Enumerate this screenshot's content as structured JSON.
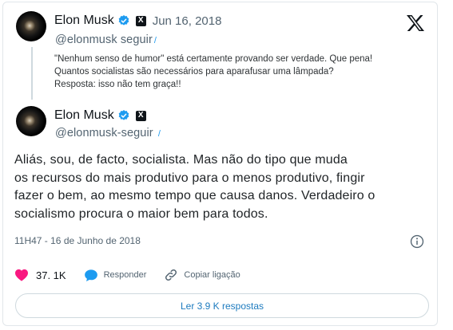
{
  "brand": {
    "logo": "x-logo",
    "accent_color": "#1d9bf0",
    "like_color": "#f91880"
  },
  "quoted_tweet": {
    "author_name": "Elon Musk",
    "author_handle": "@elonmusk",
    "follow_label": "seguir",
    "date": "Jun 16, 2018",
    "lines": [
      "\"Nenhum senso de humor\" está certamente provando ser verdade. Que pena!",
      "Quantos socialistas são necessários para aparafusar uma lâmpada?",
      "Resposta: isso não tem graça!!"
    ]
  },
  "main_tweet": {
    "author_name": "Elon Musk",
    "author_handle": "@elonmusk",
    "follow_label": "seguir",
    "text_lines": [
      "Aliás, sou, de facto, socialista. Mas não do tipo que muda",
      "os recursos do mais produtivo para o menos produtivo, fingir",
      "fazer o bem, ao mesmo tempo que causa danos. Verdadeiro o",
      "socialismo procura o maior bem para todos."
    ],
    "timestamp": "11H47 - 16 de Junho de 2018"
  },
  "actions": {
    "like_count": "37. 1K",
    "reply_label": "Responder",
    "copy_link_label": "Copiar ligação"
  },
  "replies_button": {
    "label": "Ler 3.9 K respostas"
  }
}
